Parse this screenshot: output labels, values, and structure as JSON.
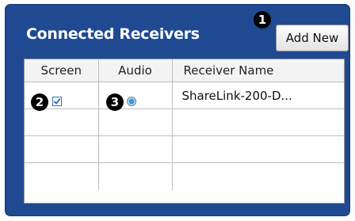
{
  "panel": {
    "title": "Connected Receivers",
    "add_button_label": "Add New"
  },
  "callouts": [
    "1",
    "2",
    "3"
  ],
  "table": {
    "columns": [
      "Screen",
      "Audio",
      "Receiver Name"
    ],
    "rows": [
      {
        "screen_checked": true,
        "audio_selected": true,
        "name": "ShareLink-200-D..."
      },
      {
        "screen_checked": false,
        "audio_selected": false,
        "name": ""
      },
      {
        "screen_checked": false,
        "audio_selected": false,
        "name": ""
      },
      {
        "screen_checked": false,
        "audio_selected": false,
        "name": ""
      }
    ]
  },
  "colors": {
    "panel_background": "#1f4a92",
    "title_text": "#ffffff",
    "header_background": "#f3f3f3"
  }
}
